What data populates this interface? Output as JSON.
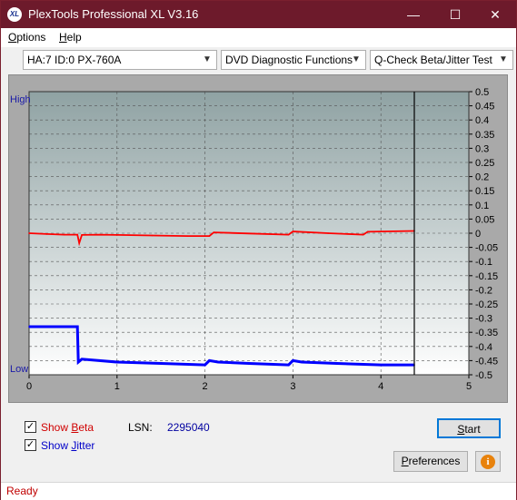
{
  "window": {
    "title": "PlexTools Professional XL V3.16",
    "icon_text": "XL",
    "controls": {
      "minimize": "—",
      "maximize": "☐",
      "close": "✕"
    }
  },
  "menu": {
    "options_label_first": "O",
    "options_label_rest": "ptions",
    "help_label_first": "H",
    "help_label_rest": "elp"
  },
  "toolbar": {
    "drive": "HA:7 ID:0  PX-760A",
    "function": "DVD Diagnostic Functions",
    "test": "Q-Check Beta/Jitter Test"
  },
  "chart": {
    "left_top_label": "High",
    "left_bottom_label": "Low",
    "colors": {
      "plot_bg_top": "#8fa2a3",
      "plot_bg_bottom": "#ffffff",
      "beta": "#ff0000",
      "jitter": "#0000ff",
      "marker": "#000000"
    }
  },
  "chart_data": {
    "type": "line",
    "x_ticks": [
      "0",
      "1",
      "2",
      "3",
      "4",
      "5"
    ],
    "xlim": [
      0,
      5
    ],
    "right_ticks": [
      "0.5",
      "0.45",
      "0.4",
      "0.35",
      "0.3",
      "0.25",
      "0.2",
      "0.15",
      "0.1",
      "0.05",
      "0",
      "-0.05",
      "-0.1",
      "-0.15",
      "-0.2",
      "-0.25",
      "-0.3",
      "-0.35",
      "-0.4",
      "-0.45",
      "-0.5"
    ],
    "ylim": [
      -0.5,
      0.5
    ],
    "end_marker_x": 4.38,
    "series": [
      {
        "name": "Beta",
        "color": "#ff0000",
        "x": [
          0,
          0.2,
          0.4,
          0.55,
          0.57,
          0.6,
          0.8,
          1.0,
          1.4,
          1.8,
          2.05,
          2.1,
          2.5,
          2.95,
          3.0,
          3.4,
          3.8,
          3.85,
          4.38
        ],
        "y": [
          0.0,
          -0.003,
          -0.005,
          -0.005,
          -0.035,
          -0.006,
          -0.005,
          -0.006,
          -0.008,
          -0.01,
          -0.01,
          0.003,
          -0.001,
          -0.005,
          0.006,
          0.0,
          -0.005,
          0.005,
          0.008
        ]
      },
      {
        "name": "Jitter",
        "color": "#0000ff",
        "x": [
          0,
          0.3,
          0.55,
          0.56,
          0.6,
          1.0,
          1.5,
          2.0,
          2.05,
          2.15,
          2.5,
          2.95,
          3.0,
          3.1,
          3.5,
          4.0,
          4.38
        ],
        "y": [
          -0.33,
          -0.33,
          -0.33,
          -0.455,
          -0.445,
          -0.455,
          -0.46,
          -0.465,
          -0.45,
          -0.455,
          -0.46,
          -0.465,
          -0.45,
          -0.455,
          -0.46,
          -0.465,
          -0.465
        ]
      }
    ]
  },
  "controls": {
    "show_beta_first": "Show ",
    "show_beta_key": "B",
    "show_beta_rest": "eta",
    "show_jitter_first": "Show ",
    "show_jitter_key": "J",
    "show_jitter_rest": "itter",
    "checkmark": "✓",
    "lsn_label": "LSN:",
    "lsn_value": "2295040",
    "start_key": "S",
    "start_rest": "tart",
    "pref_key": "P",
    "pref_rest": "references",
    "info_glyph": "i"
  },
  "status": {
    "text": "Ready"
  }
}
